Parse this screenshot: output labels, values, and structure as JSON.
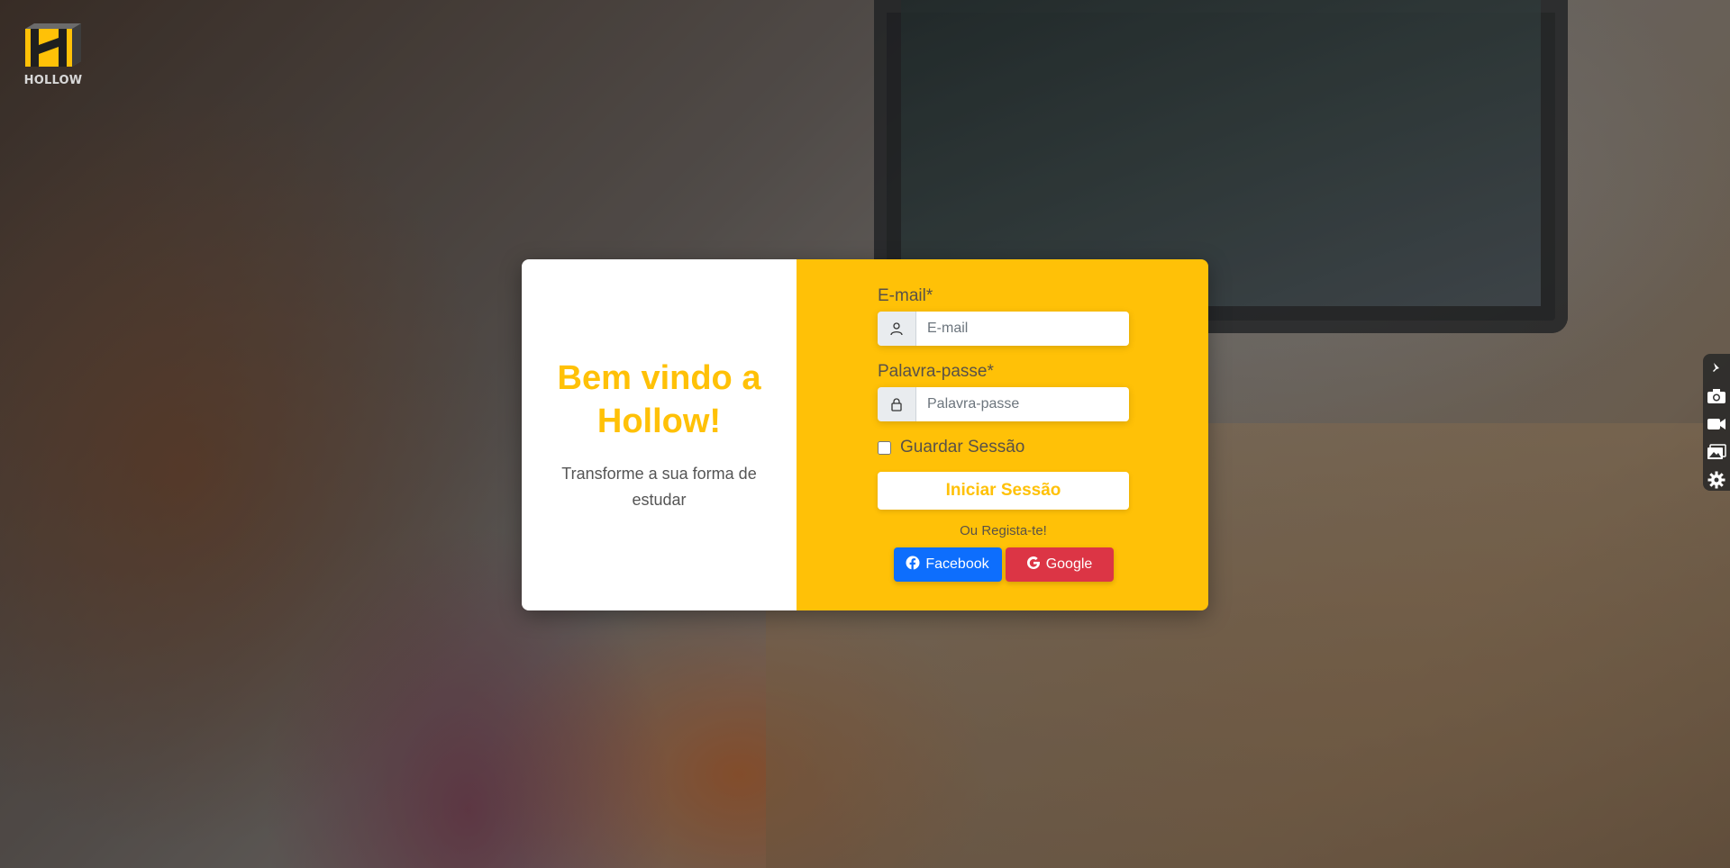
{
  "brand": {
    "logo_text": "HOLLOW",
    "primary_color": "#ffc107"
  },
  "welcome": {
    "title": "Bem vindo a Hollow!",
    "subtitle": "Transforme a sua forma de estudar"
  },
  "login_form": {
    "email_label": "E-mail*",
    "email_placeholder": "E-mail",
    "email_icon": "user-icon",
    "password_label": "Palavra-passe*",
    "password_placeholder": "Palavra-passe",
    "password_icon": "lock-icon",
    "remember_label": "Guardar Sessão",
    "remember_checked": false,
    "submit_label": "Iniciar Sessão",
    "register_text": "Ou Regista-te!",
    "facebook_label": "Facebook",
    "google_label": "Google",
    "facebook_color": "#0d6efd",
    "google_color": "#dc3545"
  },
  "side_toolbar": {
    "icons": [
      "pin-icon",
      "camera-icon",
      "video-icon",
      "gallery-icon",
      "gear-icon"
    ]
  }
}
